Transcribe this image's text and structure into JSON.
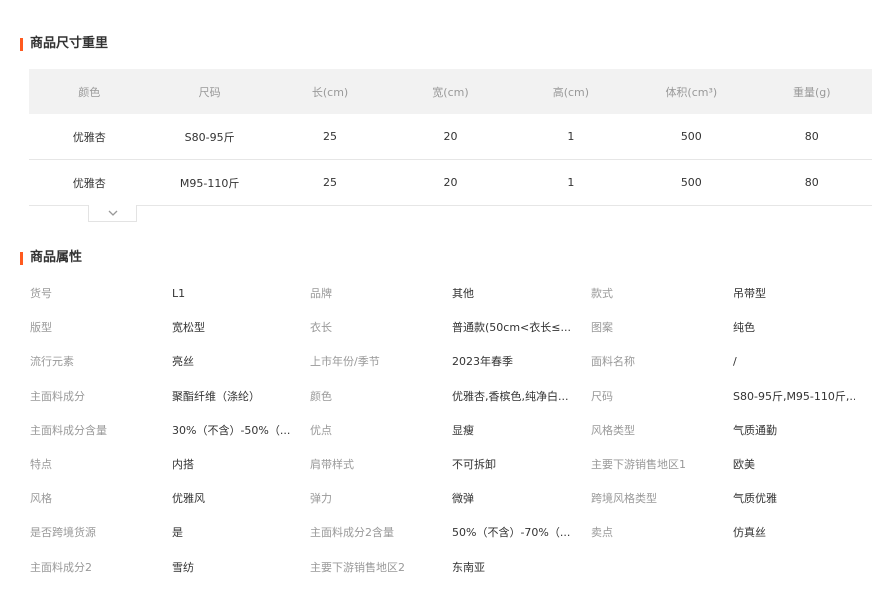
{
  "size_section": {
    "title": "商品尺寸重里",
    "headers": [
      "颜色",
      "尺码",
      "长(cm)",
      "宽(cm)",
      "高(cm)",
      "体积(cm³)",
      "重量(g)"
    ],
    "rows": [
      [
        "优雅杏",
        "S80-95斤",
        "25",
        "20",
        "1",
        "500",
        "80"
      ],
      [
        "优雅杏",
        "M95-110斤",
        "25",
        "20",
        "1",
        "500",
        "80"
      ]
    ],
    "expand_icon": "chevron-down-icon"
  },
  "attr_section": {
    "title": "商品属性",
    "rows": [
      [
        [
          "货号",
          "L1"
        ],
        [
          "品牌",
          "其他"
        ],
        [
          "款式",
          "吊带型"
        ]
      ],
      [
        [
          "版型",
          "宽松型"
        ],
        [
          "衣长",
          "普通款(50cm<衣长≤..."
        ],
        [
          "图案",
          "纯色"
        ]
      ],
      [
        [
          "流行元素",
          "亮丝"
        ],
        [
          "上市年份/季节",
          "2023年春季"
        ],
        [
          "面料名称",
          "/"
        ]
      ],
      [
        [
          "主面料成分",
          "聚酯纤维（涤纶）"
        ],
        [
          "颜色",
          "优雅杏,香槟色,纯净白..."
        ],
        [
          "尺码",
          "S80-95斤,M95-110斤,..."
        ]
      ],
      [
        [
          "主面料成分含量",
          "30%（不含）-50%（..."
        ],
        [
          "优点",
          "显瘦"
        ],
        [
          "风格类型",
          "气质通勤"
        ]
      ],
      [
        [
          "特点",
          "内搭"
        ],
        [
          "肩带样式",
          "不可拆卸"
        ],
        [
          "主要下游销售地区1",
          "欧美"
        ]
      ],
      [
        [
          "风格",
          "优雅风"
        ],
        [
          "弹力",
          "微弹"
        ],
        [
          "跨境风格类型",
          "气质优雅"
        ]
      ],
      [
        [
          "是否跨境货源",
          "是"
        ],
        [
          "主面料成分2含量",
          "50%（不含）-70%（..."
        ],
        [
          "卖点",
          "仿真丝"
        ]
      ],
      [
        [
          "主面料成分2",
          "雪纺"
        ],
        [
          "主要下游销售地区2",
          "东南亚"
        ]
      ]
    ]
  }
}
